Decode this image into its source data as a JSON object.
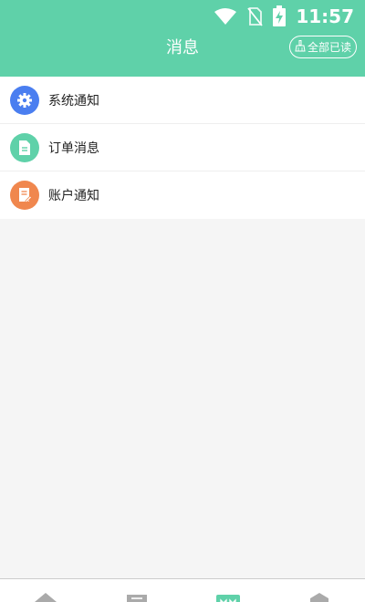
{
  "status_bar": {
    "time": "11:57",
    "icons": [
      "wifi-icon",
      "no-sim-icon",
      "battery-charging-icon"
    ]
  },
  "header": {
    "title": "消息",
    "mark_all_read": {
      "label": "全部已读",
      "icon": "broom-icon"
    }
  },
  "colors": {
    "accent": "#5fd1a9",
    "system_icon_bg": "#4a7ef0",
    "order_icon_bg": "#5fd1a9",
    "account_icon_bg": "#f0874e"
  },
  "messages": [
    {
      "label": "系统通知",
      "icon": "gear-icon"
    },
    {
      "label": "订单消息",
      "icon": "document-icon"
    },
    {
      "label": "账户通知",
      "icon": "edit-document-icon"
    }
  ],
  "bottom_nav": {
    "items": [
      {
        "icon": "home-icon",
        "active": false
      },
      {
        "icon": "list-icon",
        "active": false
      },
      {
        "icon": "message-icon",
        "active": true
      },
      {
        "icon": "profile-icon",
        "active": false
      }
    ]
  }
}
